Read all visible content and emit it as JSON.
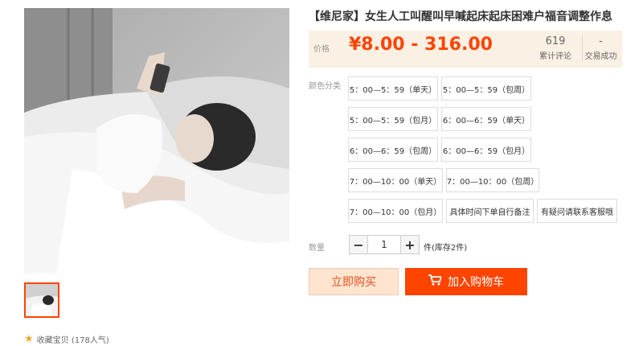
{
  "product": {
    "title": "【维尼家】女生人工叫醒叫早喊起床起床困难户福音调整作息"
  },
  "price": {
    "label": "价格",
    "value": "¥8.00 - 316.00"
  },
  "stats": {
    "reviews_count": "619",
    "reviews_label": "累计评论",
    "deals_count": "-",
    "deals_label": "交易成功"
  },
  "color_category": {
    "label": "颜色分类",
    "options": [
      "5：00—5：59（单天）",
      "5：00—5：59（包周）",
      "5：00—5：59（包月）",
      "6：00—6：59（单天）",
      "6：00—6：59（包周）",
      "6：00—6：59（包月）",
      "7：00—10：00（单天）",
      "7：00—10：00（包周）",
      "7：00—10：00（包月）",
      "具体时间下单自行备注",
      "有疑问请联系客服哦"
    ]
  },
  "quantity": {
    "label": "数量",
    "minus": "−",
    "value": "1",
    "plus": "+",
    "stock_text": "件(库存2件)"
  },
  "actions": {
    "buy_now": "立即购买",
    "add_to_cart": "加入购物车"
  },
  "favorite": {
    "text": "收藏宝贝 (178人气)"
  },
  "colors": {
    "accent": "#ff4400",
    "price_bg": "#fbf0e4",
    "buy_bg": "#ffe4d0",
    "star": "#f5a623"
  },
  "icons": {
    "cart": "cart-icon",
    "star": "star-icon"
  }
}
